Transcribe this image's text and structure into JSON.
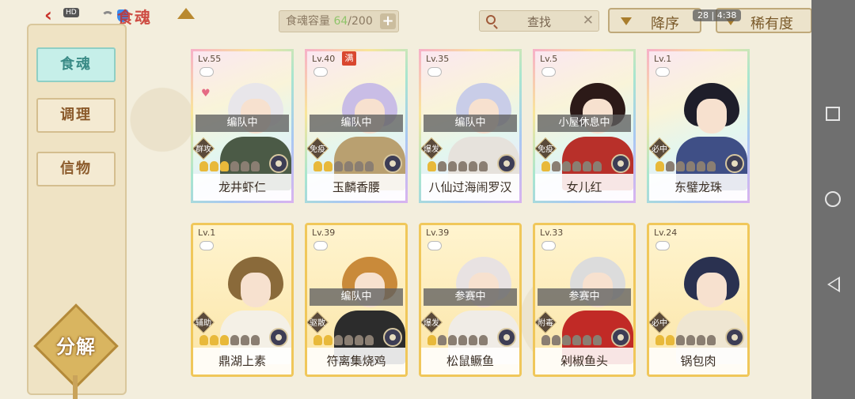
{
  "header": {
    "title": "食魂",
    "capacity_label": "食魂容量",
    "capacity_current": "64",
    "capacity_max": "/200",
    "capacity_plus": "+",
    "search_label": "查找",
    "search_clear": "✕",
    "sort_label": "降序",
    "rarity_label": "稀有度",
    "status_left": "HD",
    "status_right": "28 | 4:38",
    "back_symbol": "‹"
  },
  "sidebar": {
    "tabs": [
      {
        "label": "食魂",
        "active": true
      },
      {
        "label": "调理",
        "active": false
      },
      {
        "label": "信物",
        "active": false
      }
    ],
    "decompose_label": "分解"
  },
  "cards": [
    {
      "level": "Lv.55",
      "status": "编队中",
      "role": "群攻",
      "stars": 3,
      "name": "龙井虾仁",
      "frame": "rainbow",
      "hair": "#e8e6ea",
      "outfit": "#4b5a46",
      "heart": true,
      "full": false
    },
    {
      "level": "Lv.40",
      "status": "编队中",
      "role": "免疫",
      "stars": 2,
      "name": "玉麟香腰",
      "frame": "rainbow",
      "hair": "#c9bde6",
      "outfit": "#b9a070",
      "heart": false,
      "full": true,
      "full_label": "满"
    },
    {
      "level": "Lv.35",
      "status": "编队中",
      "role": "爆发",
      "stars": 1,
      "name": "八仙过海闹罗汉",
      "frame": "rainbow",
      "hair": "#c9cde8",
      "outfit": "#e6e2dc",
      "heart": false,
      "full": false
    },
    {
      "level": "Lv.5",
      "status": "小屋休息中",
      "role": "免疫",
      "stars": 1,
      "name": "女儿红",
      "frame": "rainbow",
      "hair": "#2c1a18",
      "outfit": "#b8302a",
      "heart": false,
      "full": false
    },
    {
      "level": "Lv.1",
      "status": "",
      "role": "必中",
      "stars": 1,
      "name": "东璧龙珠",
      "frame": "rainbow",
      "hair": "#1e1e2a",
      "outfit": "#3f4f86",
      "heart": false,
      "full": false
    },
    {
      "level": "Lv.1",
      "status": "",
      "role": "辅助",
      "stars": 3,
      "name": "鼎湖上素",
      "frame": "gold",
      "hair": "#8a6a3a",
      "outfit": "#f4f0e6",
      "heart": false,
      "full": false
    },
    {
      "level": "Lv.39",
      "status": "编队中",
      "role": "驱散",
      "stars": 2,
      "name": "符离集烧鸡",
      "frame": "gold",
      "hair": "#c98a3a",
      "outfit": "#2c2c2c",
      "heart": false,
      "full": false
    },
    {
      "level": "Lv.39",
      "status": "参赛中",
      "role": "爆发",
      "stars": 1,
      "name": "松鼠鳜鱼",
      "frame": "gold",
      "hair": "#e8e2e2",
      "outfit": "#f0ece6",
      "heart": false,
      "full": false
    },
    {
      "level": "Lv.33",
      "status": "参赛中",
      "role": "附毒",
      "stars": 0,
      "name": "剁椒鱼头",
      "frame": "gold",
      "hair": "#dcdcdc",
      "outfit": "#c12a26",
      "heart": false,
      "full": false
    },
    {
      "level": "Lv.24",
      "status": "",
      "role": "必中",
      "stars": 2,
      "name": "锅包肉",
      "frame": "gold",
      "hair": "#2a3150",
      "outfit": "#efe6d2",
      "heart": false,
      "full": false
    }
  ]
}
